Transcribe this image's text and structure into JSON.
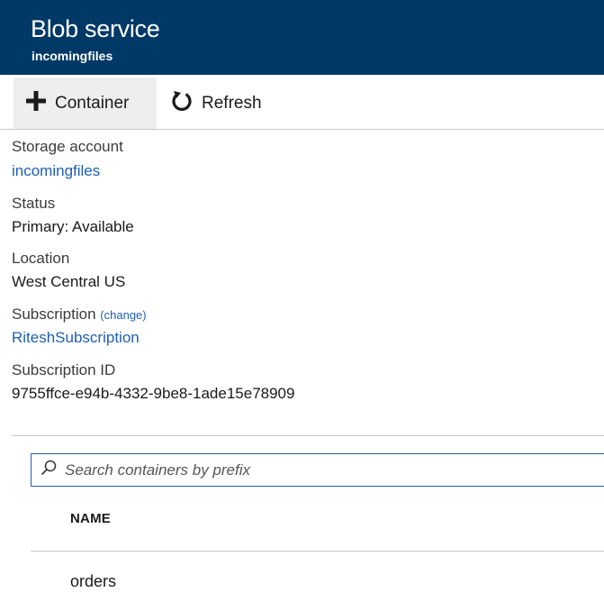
{
  "header": {
    "title": "Blob service",
    "subtitle": "incomingfiles",
    "background": "#003966"
  },
  "toolbar": {
    "container_label": "Container",
    "container_icon": "plus-icon",
    "refresh_label": "Refresh",
    "refresh_icon": "refresh-icon"
  },
  "essentials": {
    "storage_account_label": "Storage account",
    "storage_account_value": "incomingfiles",
    "status_label": "Status",
    "status_value": "Primary: Available",
    "location_label": "Location",
    "location_value": "West Central US",
    "subscription_label": "Subscription",
    "subscription_change": "(change)",
    "subscription_value": "RiteshSubscription",
    "subscription_id_label": "Subscription ID",
    "subscription_id_value": "9755ffce-e94b-4332-9be8-1ade15e78909"
  },
  "search": {
    "placeholder": "Search containers by prefix",
    "icon": "search-icon"
  },
  "table": {
    "columns": [
      "NAME"
    ],
    "rows": [
      {
        "name": "orders"
      }
    ]
  },
  "colors": {
    "link": "#1f5fb4",
    "accent": "#1f5fb4"
  }
}
